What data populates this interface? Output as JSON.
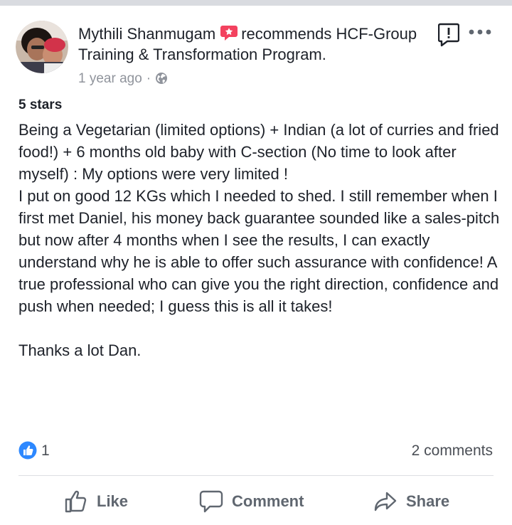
{
  "post": {
    "author": "Mythili Shanmugam",
    "recommends_text": "recommends HCF-Group Training & Transformation Program.",
    "timestamp": "1 year ago",
    "separator": "·",
    "rating": "5 stars",
    "review": "Being a Vegetarian (limited options) + Indian (a lot of curries and fried food!) + 6 months old baby with C-section (No time to look after myself) : My options were very limited !\nI put on good 12 KGs which I needed to shed. I still remember when I first met Daniel, his money back guarantee sounded like a sales-pitch but now after 4 months when I see the results, I can exactly understand why he is  able to offer such assurance with confidence! A true professional who can give you the  right direction, confidence and push when needed; I guess this is all it takes!\n\nThanks a lot Dan."
  },
  "reactions": {
    "like_count": "1",
    "comments": "2 comments"
  },
  "actions": {
    "like": "Like",
    "comment": "Comment",
    "share": "Share"
  },
  "icons": {
    "recommend": "recommend-badge-icon",
    "globe": "globe-icon",
    "report": "report-icon",
    "more": "more-options-icon",
    "like_badge": "like-badge-icon",
    "like": "thumbs-up-icon",
    "comment": "comment-bubble-icon",
    "share": "share-arrow-icon"
  },
  "colors": {
    "text": "#1d2129",
    "secondary": "#90949c",
    "action": "#606770",
    "like_blue": "#2d88ff",
    "recommend_red": "#f3425f"
  }
}
